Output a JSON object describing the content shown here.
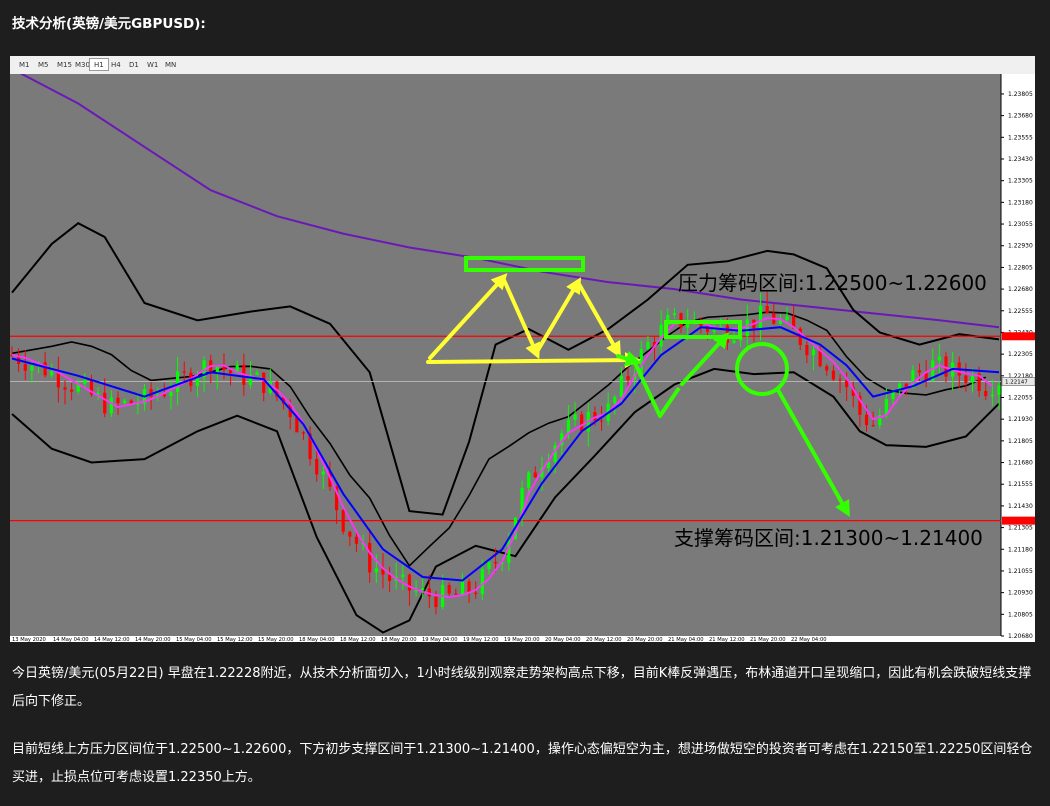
{
  "heading": "技术分析(英镑/美元GBPUSD):",
  "timeframes": [
    "M1",
    "M5",
    "M15",
    "M30",
    "H1",
    "H4",
    "D1",
    "W1",
    "MN"
  ],
  "active_timeframe": "H1",
  "chart_data": {
    "type": "candlestick",
    "symbol": "GBPUSD",
    "ylim": [
      1.2068,
      1.2392
    ],
    "y_ticks": [
      "1.23805",
      "1.23680",
      "1.23555",
      "1.23430",
      "1.23305",
      "1.23180",
      "1.23055",
      "1.22930",
      "1.22805",
      "1.22680",
      "1.22555",
      "1.22430",
      "1.22305",
      "1.22180",
      "1.22055",
      "1.21930",
      "1.21805",
      "1.21680",
      "1.21555",
      "1.21430",
      "1.21305",
      "1.21180",
      "1.21055",
      "1.20930",
      "1.20805",
      "1.20680"
    ],
    "x_ticks": [
      "13 May 2020",
      "14 May 04:00",
      "14 May 12:00",
      "14 May 20:00",
      "15 May 04:00",
      "15 May 12:00",
      "15 May 20:00",
      "18 May 04:00",
      "18 May 12:00",
      "18 May 20:00",
      "19 May 04:00",
      "19 May 12:00",
      "19 May 20:00",
      "20 May 04:00",
      "20 May 12:00",
      "20 May 20:00",
      "21 May 04:00",
      "21 May 12:00",
      "21 May 20:00",
      "22 May 04:00"
    ],
    "price_path": [
      [
        0,
        1.223
      ],
      [
        5,
        1.2222
      ],
      [
        10,
        1.2211
      ],
      [
        15,
        1.22
      ],
      [
        20,
        1.2204
      ],
      [
        25,
        1.2214
      ],
      [
        30,
        1.2226
      ],
      [
        33,
        1.222
      ],
      [
        38,
        1.2214
      ],
      [
        42,
        1.2198
      ],
      [
        46,
        1.2168
      ],
      [
        50,
        1.2134
      ],
      [
        54,
        1.211
      ],
      [
        58,
        1.2098
      ],
      [
        62,
        1.2092
      ],
      [
        66,
        1.209
      ],
      [
        70,
        1.2096
      ],
      [
        74,
        1.2116
      ],
      [
        77,
        1.215
      ],
      [
        80,
        1.217
      ],
      [
        83,
        1.2185
      ],
      [
        87,
        1.2194
      ],
      [
        90,
        1.2198
      ],
      [
        93,
        1.2218
      ],
      [
        96,
        1.2236
      ],
      [
        99,
        1.2248
      ],
      [
        102,
        1.225
      ],
      [
        105,
        1.2246
      ],
      [
        108,
        1.2244
      ],
      [
        111,
        1.2248
      ],
      [
        114,
        1.2253
      ],
      [
        117,
        1.2246
      ],
      [
        120,
        1.2236
      ],
      [
        123,
        1.2226
      ],
      [
        126,
        1.2212
      ],
      [
        128,
        1.2196
      ],
      [
        130,
        1.219
      ],
      [
        133,
        1.2206
      ],
      [
        136,
        1.2218
      ],
      [
        139,
        1.2224
      ],
      [
        142,
        1.222
      ],
      [
        145,
        1.2218
      ],
      [
        147,
        1.2212
      ],
      [
        149,
        1.2216
      ]
    ],
    "ma_blue": [
      [
        0,
        1.2228
      ],
      [
        10,
        1.2218
      ],
      [
        20,
        1.2206
      ],
      [
        30,
        1.222
      ],
      [
        38,
        1.2216
      ],
      [
        44,
        1.219
      ],
      [
        50,
        1.215
      ],
      [
        56,
        1.2118
      ],
      [
        62,
        1.2102
      ],
      [
        68,
        1.21
      ],
      [
        74,
        1.2118
      ],
      [
        80,
        1.2156
      ],
      [
        86,
        1.2186
      ],
      [
        92,
        1.2202
      ],
      [
        98,
        1.223
      ],
      [
        104,
        1.2246
      ],
      [
        110,
        1.2244
      ],
      [
        116,
        1.2246
      ],
      [
        122,
        1.2236
      ],
      [
        126,
        1.2224
      ],
      [
        130,
        1.2206
      ],
      [
        136,
        1.2212
      ],
      [
        142,
        1.2222
      ],
      [
        149,
        1.222
      ]
    ],
    "bb_upper": [
      [
        0,
        1.2266
      ],
      [
        6,
        1.2294
      ],
      [
        10,
        1.2306
      ],
      [
        14,
        1.2298
      ],
      [
        20,
        1.226
      ],
      [
        28,
        1.225
      ],
      [
        36,
        1.2255
      ],
      [
        42,
        1.2258
      ],
      [
        48,
        1.2248
      ],
      [
        54,
        1.222
      ],
      [
        60,
        1.214
      ],
      [
        65,
        1.2138
      ],
      [
        69,
        1.218
      ],
      [
        73,
        1.2236
      ],
      [
        78,
        1.2245
      ],
      [
        84,
        1.2233
      ],
      [
        90,
        1.2245
      ],
      [
        96,
        1.2262
      ],
      [
        102,
        1.2282
      ],
      [
        108,
        1.2284
      ],
      [
        114,
        1.229
      ],
      [
        118,
        1.2288
      ],
      [
        123,
        1.228
      ],
      [
        127,
        1.2256
      ],
      [
        131,
        1.2243
      ],
      [
        137,
        1.2236
      ],
      [
        143,
        1.2242
      ],
      [
        149,
        1.2239
      ]
    ],
    "bb_lower": [
      [
        0,
        1.2196
      ],
      [
        6,
        1.2176
      ],
      [
        12,
        1.2168
      ],
      [
        20,
        1.217
      ],
      [
        28,
        1.2186
      ],
      [
        34,
        1.2195
      ],
      [
        40,
        1.2186
      ],
      [
        46,
        1.2125
      ],
      [
        52,
        1.208
      ],
      [
        56,
        1.207
      ],
      [
        60,
        1.2077
      ],
      [
        64,
        1.2108
      ],
      [
        70,
        1.212
      ],
      [
        76,
        1.2114
      ],
      [
        82,
        1.2148
      ],
      [
        88,
        1.2172
      ],
      [
        94,
        1.2197
      ],
      [
        100,
        1.2213
      ],
      [
        106,
        1.2222
      ],
      [
        112,
        1.2219
      ],
      [
        118,
        1.222
      ],
      [
        124,
        1.2206
      ],
      [
        128,
        1.2186
      ],
      [
        132,
        1.2178
      ],
      [
        138,
        1.2177
      ],
      [
        144,
        1.2183
      ],
      [
        149,
        1.2202
      ]
    ],
    "ma_purple": [
      [
        0,
        1.2395
      ],
      [
        10,
        1.2375
      ],
      [
        20,
        1.235
      ],
      [
        30,
        1.2325
      ],
      [
        40,
        1.231
      ],
      [
        50,
        1.23
      ],
      [
        60,
        1.2292
      ],
      [
        70,
        1.2286
      ],
      [
        80,
        1.2278
      ],
      [
        90,
        1.2272
      ],
      [
        100,
        1.2268
      ],
      [
        110,
        1.2262
      ],
      [
        120,
        1.2258
      ],
      [
        130,
        1.2254
      ],
      [
        140,
        1.225
      ],
      [
        149,
        1.2246
      ]
    ],
    "h_lines": [
      1.22408,
      1.21345
    ],
    "current_price": 1.22147,
    "colors": {
      "background": "#7a7a7a",
      "grid": "#8a8a8a",
      "ma_blue": "#0000ff",
      "ma_magenta": "#ff33ff",
      "bollinger": "#000000",
      "ma_long": "#6a19b8",
      "h_line": "#ff0000",
      "up": "#00ff00",
      "down": "#ff0000",
      "pattern": "#ffff33",
      "annotation": "#33ff00"
    }
  },
  "label_resistance": "压力筹码区间:1.22500~1.22600",
  "label_support": "支撑筹码区间:1.21300~1.21400",
  "paragraph1": "今日英镑/美元(05月22日) 早盘在1.22228附近，从技术分析面切入，1小时线级别观察走势架构高点下移，目前K棒反弹遇压，布林通道开口呈现缩口，因此有机会跌破短线支撑后向下修正。",
  "paragraph2": "目前短线上方压力区间位于1.22500~1.22600，下方初步支撑区间于1.21300~1.21400，操作心态偏短空为主，想进场做短空的投资者可考虑在1.22150至1.22250区间轻仓买进，止损点位可考虑设置1.22350上方。"
}
